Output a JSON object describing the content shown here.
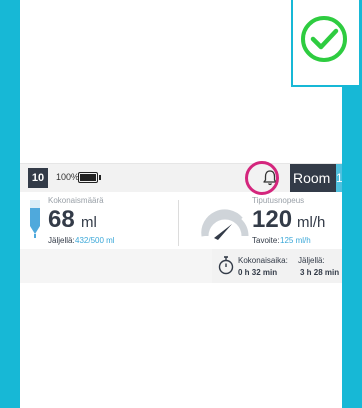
{
  "topbar": {
    "bed_number": "10",
    "battery_percent": "100%",
    "room_label": "Room 1",
    "room_tab": "1"
  },
  "volume": {
    "label": "Kokonaismäärä",
    "value": "68",
    "unit": "ml",
    "remaining_label": "Jäljellä:",
    "remaining_value": "432/500 ml"
  },
  "rate": {
    "label": "Tiputusnopeus",
    "value": "120",
    "unit": "ml/h",
    "target_label": "Tavoite:",
    "target_value": "125 ml/h"
  },
  "time": {
    "total_label": "Kokonaisaika:",
    "total_value": "0 h 32 min",
    "remaining_label": "Jäljellä:",
    "remaining_value": "3 h 28 min"
  },
  "colors": {
    "accent": "#17b8d6",
    "highlight": "#d4267d",
    "check": "#2ecc40",
    "dark": "#333b48",
    "blue_text": "#3aa7d8"
  },
  "icons": {
    "check": "check-circle-icon",
    "bell": "bell-icon",
    "battery": "battery-icon",
    "timer": "timer-icon",
    "tube": "iv-bag-icon",
    "gauge": "gauge-icon"
  }
}
